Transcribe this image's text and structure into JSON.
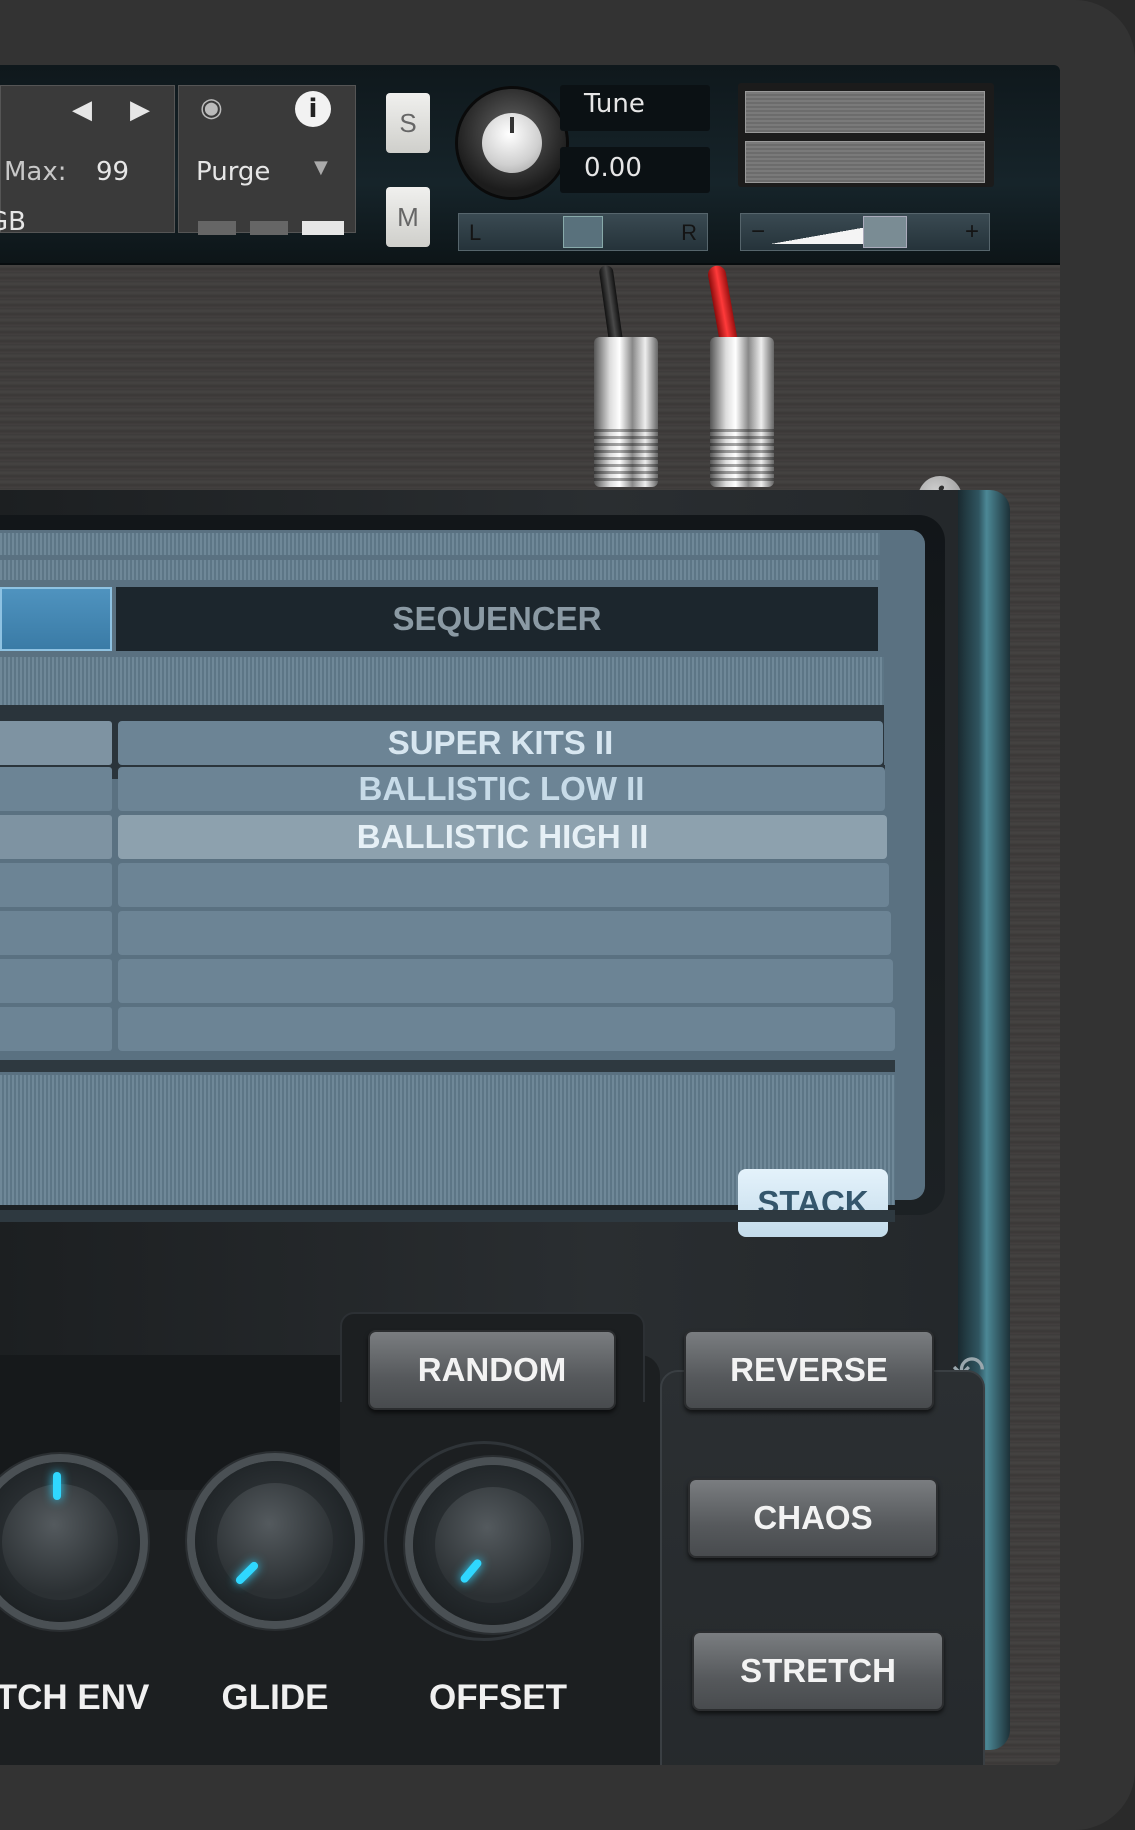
{
  "header": {
    "max_label": "Max:",
    "max_value": "99",
    "memory_partial": "GB",
    "purge_label": "Purge",
    "solo_label": "S",
    "mute_label": "M",
    "tune_label": "Tune",
    "tune_value": "0.00",
    "pan_left": "L",
    "pan_right": "R",
    "vol_minus": "−",
    "vol_plus": "+"
  },
  "info_label": "i",
  "screen": {
    "tab_sequencer": "SEQUENCER",
    "kits": [
      "SUPER KITS II",
      "BALLISTIC LOW II",
      "BALLISTIC HIGH II"
    ],
    "selected_kit": "BALLISTIC HIGH II",
    "stack_label": "STACK"
  },
  "controls": {
    "random_label": "RANDOM",
    "reverse_label": "REVERSE",
    "chaos_label": "CHAOS",
    "stretch_label": "STRETCH",
    "knobs": [
      "TCH ENV",
      "GLIDE",
      "OFFSET"
    ]
  },
  "colors": {
    "led": "#2fd7ff",
    "screen": "#5a7181",
    "cable_red": "#e41e1e"
  }
}
